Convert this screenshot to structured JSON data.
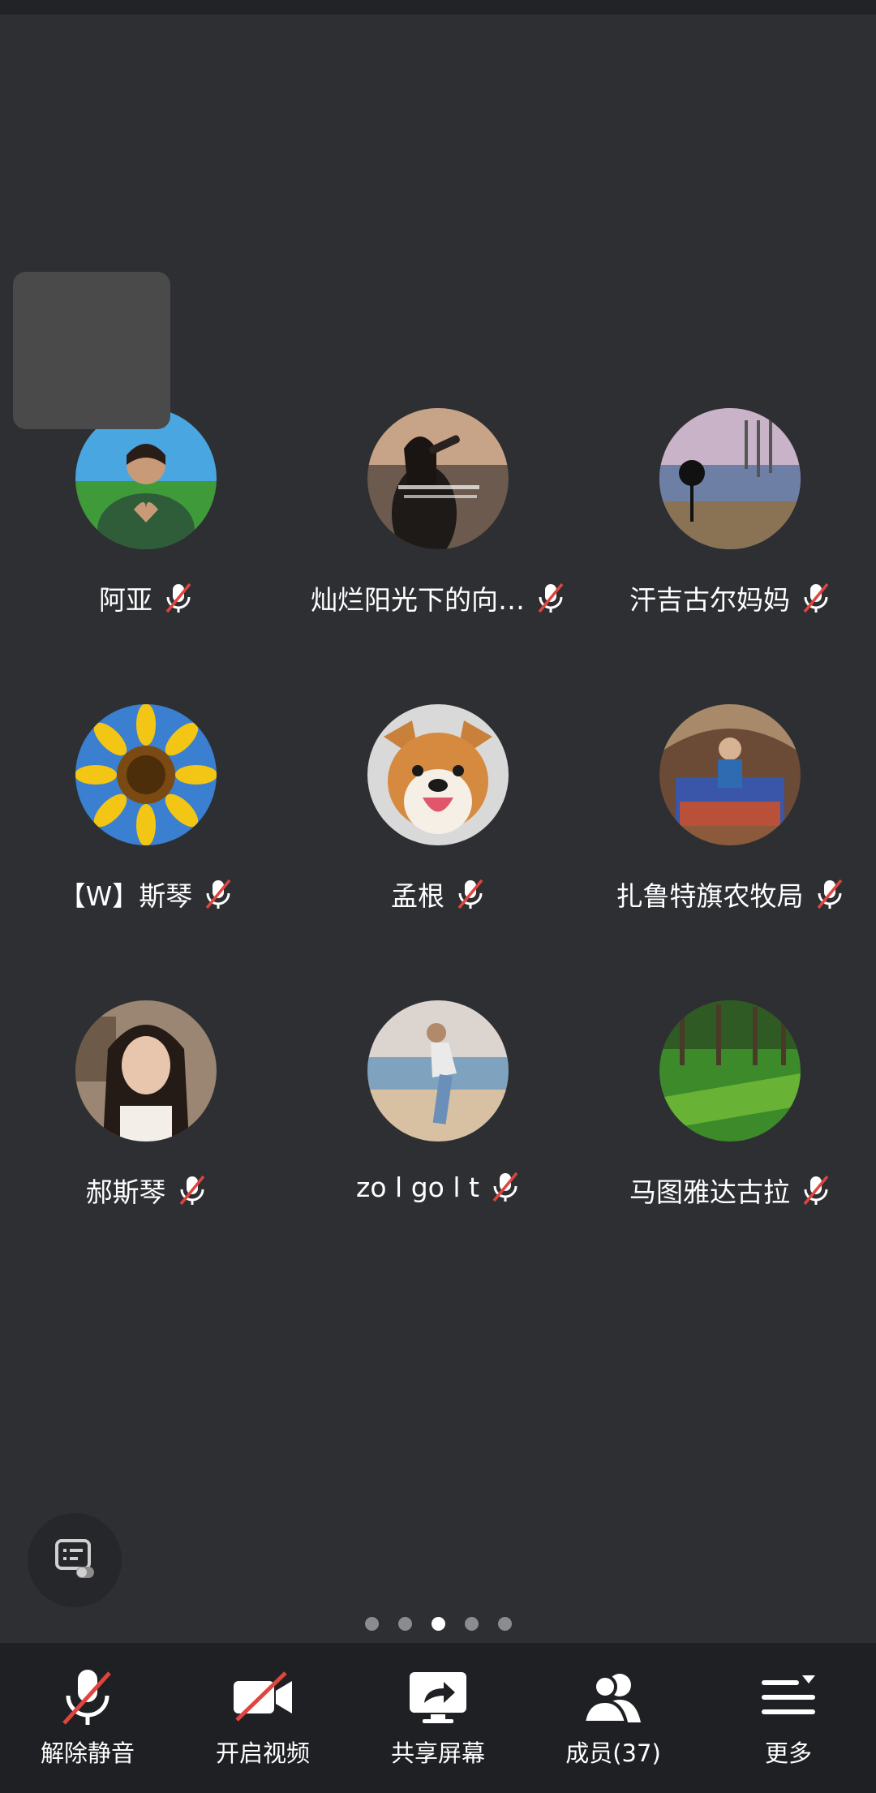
{
  "participants": [
    {
      "name": "阿亚",
      "muted": true,
      "avatar": "woman-heart-hands"
    },
    {
      "name": "灿烂阳光下的向…",
      "muted": true,
      "avatar": "woman-drinking"
    },
    {
      "name": "汗吉古尔妈妈",
      "muted": true,
      "avatar": "landscape-tree"
    },
    {
      "name": "【W】斯琴",
      "muted": true,
      "avatar": "sunflower"
    },
    {
      "name": "孟根",
      "muted": true,
      "avatar": "shiba-dog"
    },
    {
      "name": "扎鲁特旗农牧局",
      "muted": true,
      "avatar": "child-in-yurt"
    },
    {
      "name": "郝斯琴",
      "muted": true,
      "avatar": "woman-portrait"
    },
    {
      "name": "zo l go l t",
      "muted": true,
      "avatar": "woman-beach"
    },
    {
      "name": "马图雅达古拉",
      "muted": true,
      "avatar": "green-park"
    }
  ],
  "pagination": {
    "pages": 5,
    "current": 3
  },
  "toolbar": {
    "unmute": "解除静音",
    "start_video": "开启视频",
    "share_screen": "共享屏幕",
    "members": "成员(37)",
    "more": "更多"
  },
  "colors": {
    "background": "#2d2f33",
    "toolbar": "#1f2023",
    "muted_slash": "#e0443e"
  }
}
